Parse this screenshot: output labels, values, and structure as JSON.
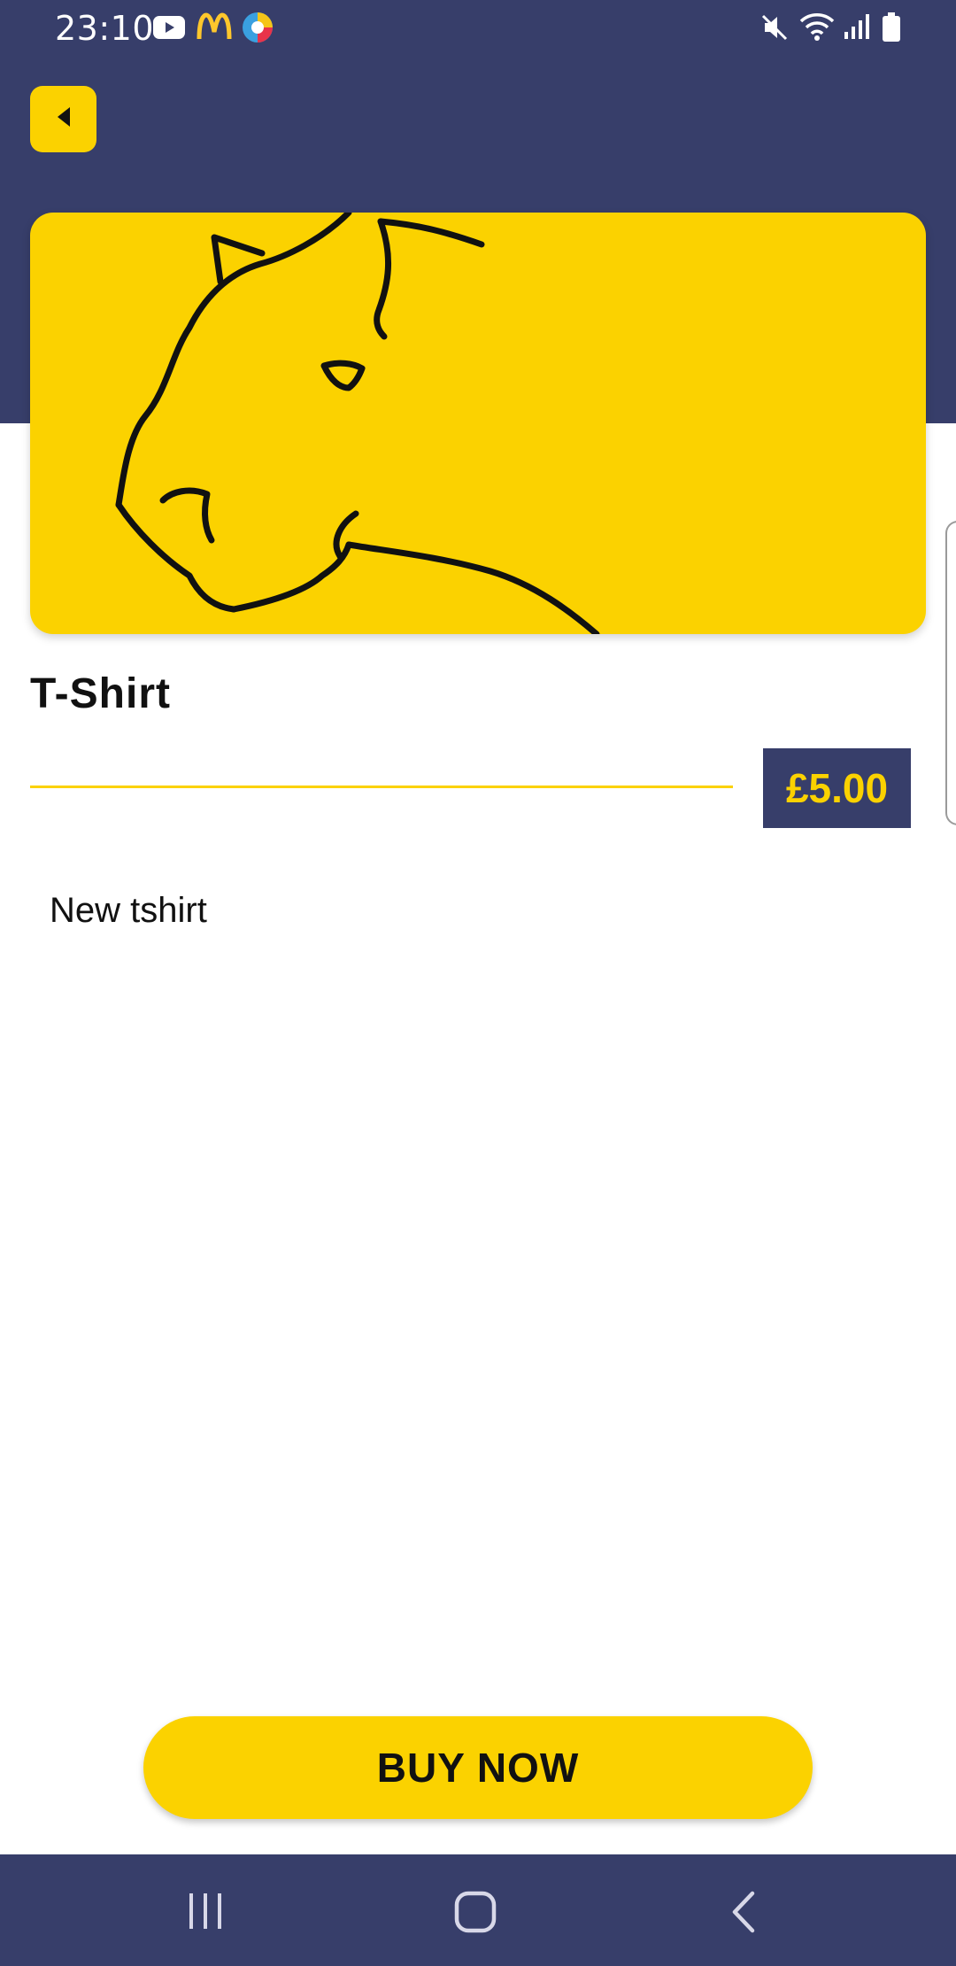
{
  "status_bar": {
    "time": "23:10",
    "left_icons": [
      "youtube-icon",
      "mcdonalds-icon",
      "browser-icon"
    ],
    "right_icons": [
      "mute-icon",
      "wifi-icon",
      "signal-icon",
      "battery-icon"
    ]
  },
  "header": {
    "back_icon": "back-arrow-icon"
  },
  "product": {
    "title": "T-Shirt",
    "price": "£5.00",
    "description": "New tshirt",
    "image": "panther-illustration"
  },
  "actions": {
    "buy_label": "BUY NOW"
  },
  "nav": {
    "items": [
      "recent-apps-icon",
      "home-icon",
      "back-icon"
    ]
  },
  "colors": {
    "primary": "#373E6A",
    "accent": "#FBD200",
    "text": "#111111"
  }
}
